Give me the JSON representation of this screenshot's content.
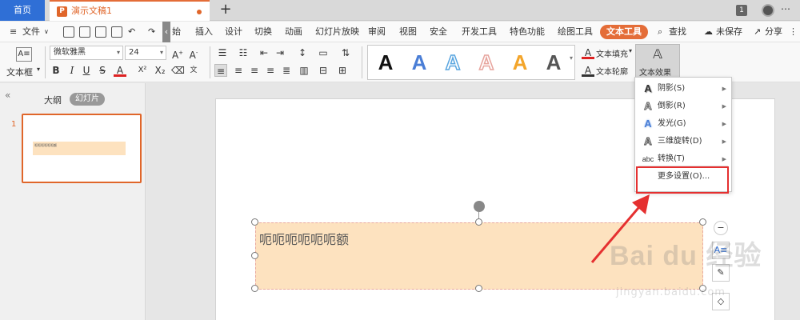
{
  "tabbar": {
    "home": "首页",
    "doc_title": "演示文稿1",
    "new_tab": "+",
    "badge": "1"
  },
  "menubar": {
    "file": "文件",
    "items": [
      "始",
      "插入",
      "设计",
      "切换",
      "动画",
      "幻灯片放映",
      "审阅",
      "视图",
      "安全",
      "开发工具",
      "特色功能",
      "绘图工具",
      "文本工具",
      "查找"
    ],
    "unsaved": "未保存",
    "share": "分享"
  },
  "ribbon": {
    "textbox_label": "文本框",
    "font_name": "微软雅黑",
    "font_size": "24",
    "bold": "B",
    "italic": "I",
    "underline": "U",
    "strike": "S",
    "font_color": "A",
    "superscript": "X²",
    "text_fill": "文本填充",
    "text_outline": "文本轮廓",
    "text_effect": "文本效果"
  },
  "gallery": {
    "styles": [
      {
        "glyph": "A",
        "color": "#111111"
      },
      {
        "glyph": "A",
        "color": "#4a7ed6"
      },
      {
        "glyph": "A",
        "color": "#5aa6e0"
      },
      {
        "glyph": "A",
        "color": "#e7a49d"
      },
      {
        "glyph": "A",
        "color": "#f3a52b"
      },
      {
        "glyph": "A",
        "color": "#555555"
      }
    ]
  },
  "left_panel": {
    "outline_tab": "大纲",
    "slides_tab": "幻灯片",
    "slide_number": "1",
    "thumb_text": "呃呃呃呃呃呃额"
  },
  "slide": {
    "textbox_text": "呃呃呃呃呃呃额"
  },
  "dropdown": {
    "items": [
      {
        "label": "阴影(S)",
        "icon": "shadow-a-icon",
        "submenu": true
      },
      {
        "label": "倒影(R)",
        "icon": "reflection-a-icon",
        "submenu": true
      },
      {
        "label": "发光(G)",
        "icon": "glow-a-icon",
        "submenu": true
      },
      {
        "label": "三维旋转(D)",
        "icon": "rotation-3d-a-icon",
        "submenu": true
      },
      {
        "label": "转换(T)",
        "icon": "transform-abc-icon",
        "submenu": true
      },
      {
        "label": "更多设置(O)...",
        "icon": "",
        "submenu": false
      }
    ],
    "abc_glyph": "abc"
  },
  "watermark": {
    "brand": "Bai du 经验",
    "sub": "jingyan.baidu.com"
  },
  "colors": {
    "accent": "#e46d38",
    "home_tab": "#2f6fd6",
    "textbox_fill": "#fde2bf",
    "highlight": "#e53030"
  }
}
